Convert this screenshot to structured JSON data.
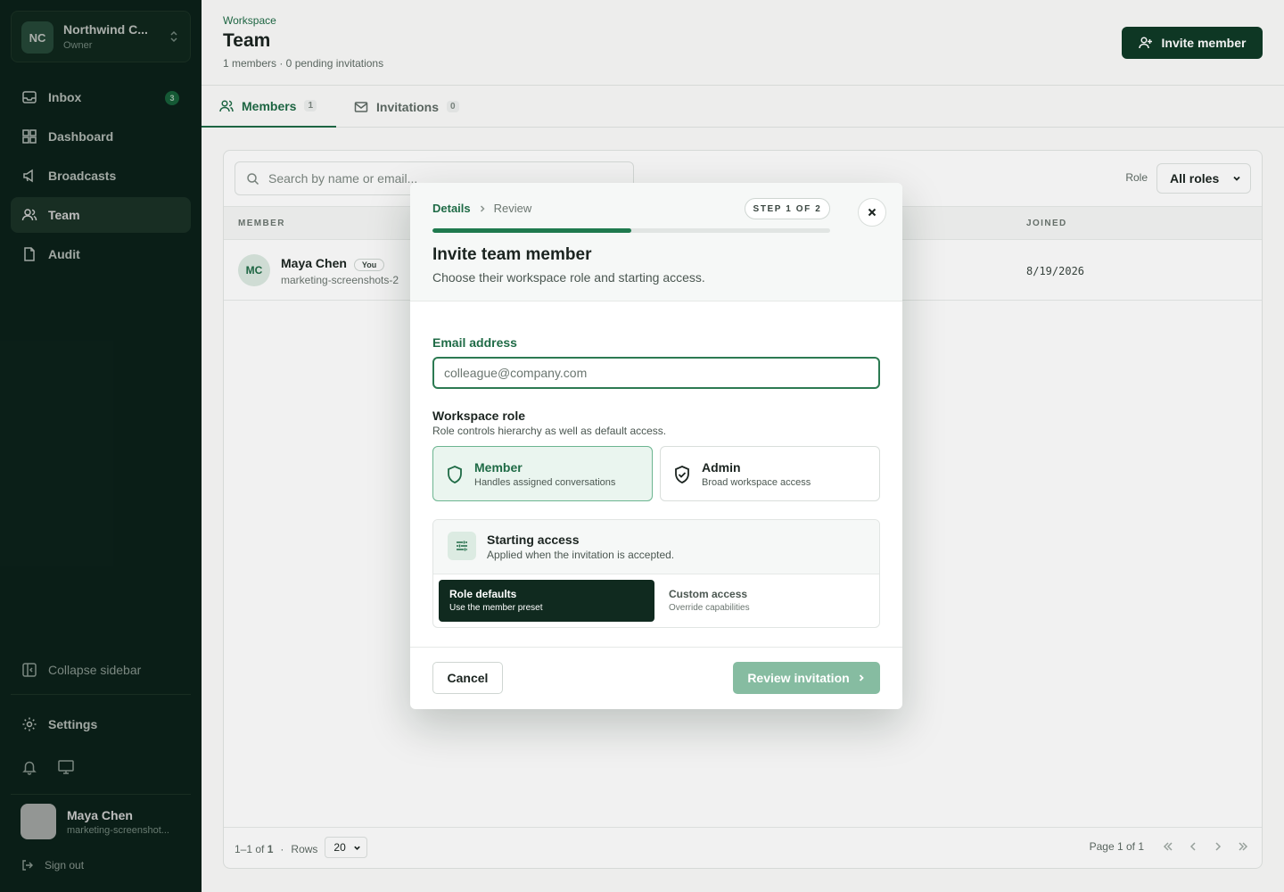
{
  "workspace": {
    "initials": "NC",
    "name": "Northwind C...",
    "role": "Owner"
  },
  "nav": {
    "items": [
      {
        "label": "Inbox",
        "badge": "3"
      },
      {
        "label": "Dashboard"
      },
      {
        "label": "Broadcasts"
      },
      {
        "label": "Team"
      },
      {
        "label": "Audit"
      }
    ],
    "collapse_label": "Collapse sidebar",
    "settings_label": "Settings"
  },
  "user": {
    "name": "Maya Chen",
    "email": "marketing-screenshot...",
    "signout_label": "Sign out"
  },
  "header": {
    "breadcrumb": "Workspace",
    "title": "Team",
    "subtitle": "1 members · 0 pending invitations",
    "invite_button": "Invite member"
  },
  "tabs": [
    {
      "label": "Members",
      "count": "1"
    },
    {
      "label": "Invitations",
      "count": "0"
    }
  ],
  "table": {
    "search_placeholder": "Search by name or email...",
    "role_label": "Role",
    "role_value": "All roles",
    "columns": {
      "member": "MEMBER",
      "joined": "JOINED"
    },
    "rows": [
      {
        "initials": "MC",
        "name": "Maya Chen",
        "tag": "You",
        "email": "marketing-screenshots-2",
        "joined": "8/19/2026"
      }
    ],
    "footer": {
      "range_prefix": "1–1 of",
      "range_total": "1",
      "rows_label": "Rows",
      "rows_value": "20",
      "page_text": "Page 1 of 1"
    }
  },
  "modal": {
    "steps": [
      "Details",
      "Review"
    ],
    "step_badge": "STEP 1 OF 2",
    "progress": 0.5,
    "title": "Invite team member",
    "subtitle": "Choose their workspace role and starting access.",
    "email_label": "Email address",
    "email_placeholder": "colleague@company.com",
    "role_label": "Workspace role",
    "role_hint": "Role controls hierarchy as well as default access.",
    "roles": [
      {
        "title": "Member",
        "desc": "Handles assigned conversations",
        "selected": true
      },
      {
        "title": "Admin",
        "desc": "Broad workspace access",
        "selected": false
      }
    ],
    "access": {
      "title": "Starting access",
      "subtitle": "Applied when the invitation is accepted.",
      "options": [
        {
          "title": "Role defaults",
          "desc": "Use the member preset",
          "selected": true
        },
        {
          "title": "Custom access",
          "desc": "Override capabilities",
          "selected": false
        }
      ]
    },
    "cancel_label": "Cancel",
    "review_label": "Review invitation"
  },
  "colors": {
    "sidebar": "#0f2a20",
    "accent": "#1f6b46",
    "primary_button": "#0f3b27",
    "disabled_button": "#86bca1"
  }
}
